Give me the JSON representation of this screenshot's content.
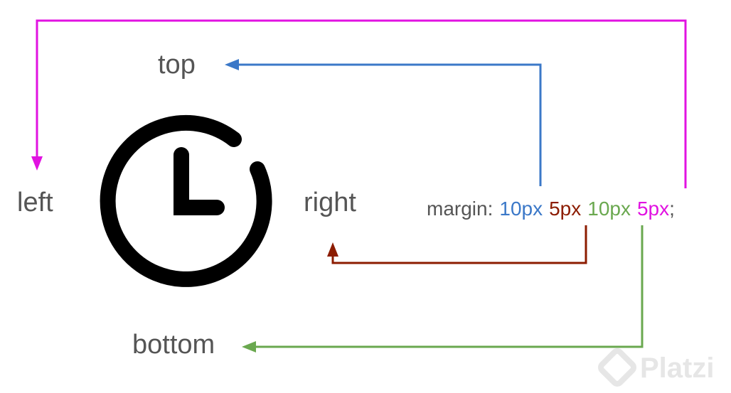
{
  "labels": {
    "top": "top",
    "left": "left",
    "right": "right",
    "bottom": "bottom"
  },
  "code": {
    "property": "margin:",
    "top_value": "10px",
    "right_value": "5px",
    "bottom_value": "10px",
    "left_value": "5px",
    "terminator": ";"
  },
  "watermark": {
    "text": "Platzi"
  },
  "icons": {
    "center": "clock-icon",
    "watermark": "platzi-logo-icon"
  },
  "colors": {
    "text": "#555555",
    "top": "#3b78c8",
    "right": "#8c1c00",
    "bottom": "#6aa84f",
    "left": "#e112e1",
    "icon": "#000000",
    "watermark": "#e6e6e6"
  }
}
